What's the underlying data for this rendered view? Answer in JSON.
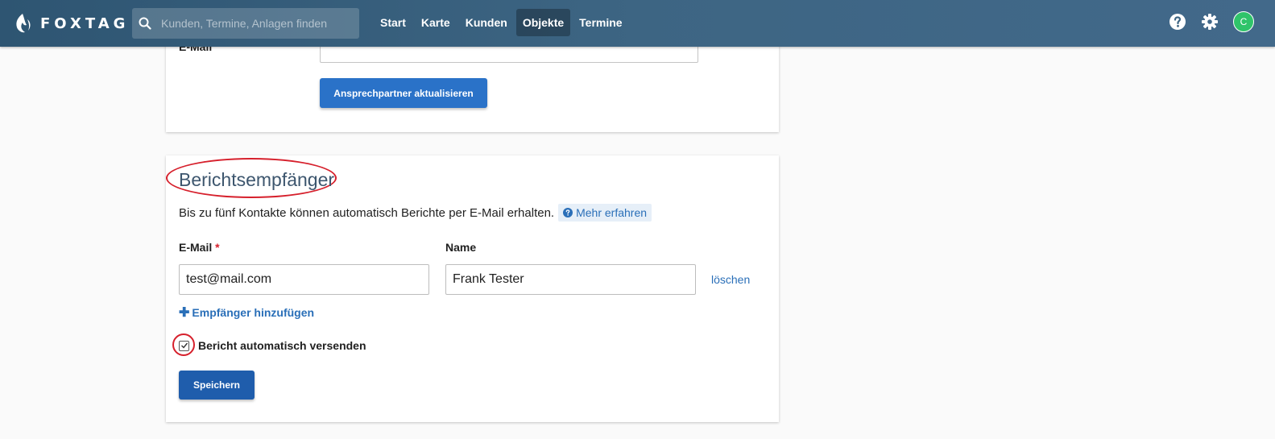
{
  "header": {
    "logo_text": "FOXTAG",
    "search_placeholder": "Kunden, Termine, Anlagen finden",
    "nav": [
      {
        "label": "Start",
        "active": false
      },
      {
        "label": "Karte",
        "active": false
      },
      {
        "label": "Kunden",
        "active": false
      },
      {
        "label": "Objekte",
        "active": true
      },
      {
        "label": "Termine",
        "active": false
      }
    ],
    "avatar_initial": "C"
  },
  "contact_card": {
    "email_label": "E-Mail",
    "update_button": "Ansprechpartner aktualisieren"
  },
  "report_recipients": {
    "title": "Berichtsempfänger",
    "description": "Bis zu fünf Kontakte können automatisch Berichte per E-Mail erhalten.",
    "more_link": "Mehr erfahren",
    "email_label": "E-Mail",
    "required_mark": "*",
    "name_label": "Name",
    "email_value": "test@mail.com",
    "name_value": "Frank Tester",
    "delete_label": "löschen",
    "add_label": "Empfänger hinzufügen",
    "auto_send_label": "Bericht automatisch versenden",
    "auto_send_checked": true,
    "save_button": "Speichern"
  },
  "colors": {
    "header_bg": "#3d6583",
    "primary_button": "#2a72c8",
    "save_button": "#1f5dac",
    "link": "#2a6fb8",
    "annotation": "#d6202c",
    "avatar": "#2fc46a"
  }
}
